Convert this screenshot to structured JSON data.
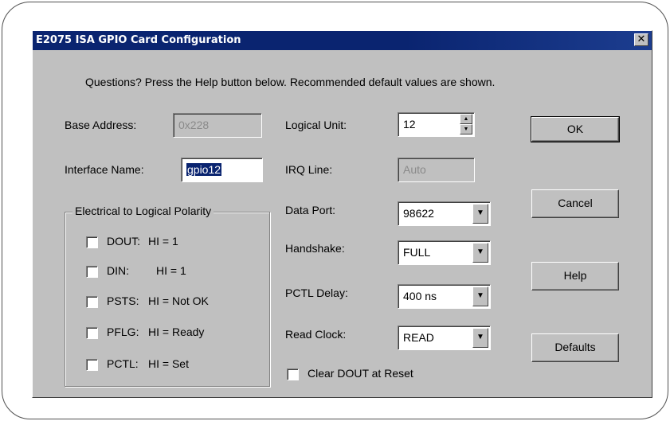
{
  "window": {
    "title": "E2075 ISA GPIO Card Configuration",
    "close_glyph": "✕"
  },
  "instructions": "Questions?  Press the Help button below.  Recommended default values are shown.",
  "base_address": {
    "label": "Base Address:",
    "value": "0x228"
  },
  "interface_name": {
    "label": "Interface Name:",
    "value": "gpio12"
  },
  "logical_unit": {
    "label": "Logical Unit:",
    "value": "12"
  },
  "irq_line": {
    "label": "IRQ Line:",
    "value": "Auto"
  },
  "data_port": {
    "label": "Data Port:",
    "value": "98622"
  },
  "handshake": {
    "label": "Handshake:",
    "value": "FULL"
  },
  "pctl_delay": {
    "label": "PCTL Delay:",
    "value": "400 ns"
  },
  "read_clock": {
    "label": "Read Clock:",
    "value": "READ"
  },
  "clear_dout": {
    "label": "Clear DOUT at Reset",
    "checked": false
  },
  "polarity": {
    "title": "Electrical to Logical Polarity",
    "items": [
      {
        "name": "DOUT:",
        "desc": "HI = 1",
        "checked": false
      },
      {
        "name": "DIN:",
        "desc": "HI = 1",
        "checked": false
      },
      {
        "name": "PSTS:",
        "desc": "HI = Not OK",
        "checked": false
      },
      {
        "name": "PFLG:",
        "desc": "HI = Ready",
        "checked": false
      },
      {
        "name": "PCTL:",
        "desc": "HI = Set",
        "checked": false
      }
    ]
  },
  "buttons": {
    "ok": "OK",
    "cancel": "Cancel",
    "help": "Help",
    "defaults": "Defaults"
  },
  "icons": {
    "spin_up": "▲",
    "spin_down": "▼",
    "dropdown": "▼"
  }
}
